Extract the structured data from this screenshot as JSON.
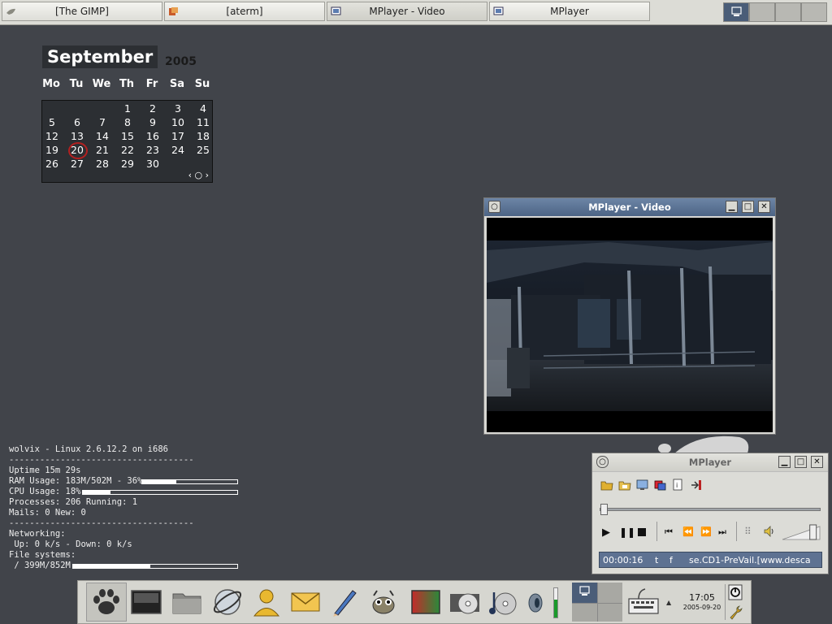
{
  "taskbar": {
    "tasks": [
      {
        "label": "[The GIMP]"
      },
      {
        "label": "[aterm]"
      },
      {
        "label": "MPlayer - Video"
      },
      {
        "label": "MPlayer"
      }
    ]
  },
  "calendar": {
    "month": "September",
    "year": "2005",
    "weekdays": [
      "Mo",
      "Tu",
      "We",
      "Th",
      "Fr",
      "Sa",
      "Su"
    ],
    "days": [
      "1",
      "2",
      "3",
      "4",
      "5",
      "6",
      "7",
      "8",
      "9",
      "10",
      "11",
      "12",
      "13",
      "14",
      "15",
      "16",
      "17",
      "18",
      "19",
      "20",
      "21",
      "22",
      "23",
      "24",
      "25",
      "26",
      "27",
      "28",
      "29",
      "30"
    ],
    "today": "20",
    "nav": "‹ ○ ›"
  },
  "conky": {
    "header": "wolvix - Linux 2.6.12.2 on i686",
    "separator": "------------------------------------",
    "uptime": "Uptime 15m 29s",
    "ram": "RAM Usage: 183M/502M - 36%",
    "ram_fraction": 0.36,
    "cpu": "CPU Usage: 18%",
    "cpu_fraction": 0.18,
    "processes": "Processes: 206  Running: 1",
    "mails": "Mails: 0 New: 0",
    "networking": "Networking:",
    "net_rates": " Up: 0 k/s - Down: 0 k/s",
    "filesystems": "File systems:",
    "fs": " / 399M/852M",
    "fs_fraction": 0.47
  },
  "video_window": {
    "title": "MPlayer - Video"
  },
  "mplayer": {
    "title": "MPlayer",
    "time": "00:00:16",
    "flag_t": "t",
    "flag_f": "f",
    "filename": "se.CD1-PreVail.[www.desca",
    "seek_fraction": 0.0,
    "volume_fraction": 0.85
  },
  "clock": {
    "time": "17:05",
    "date": "2005-09-20"
  },
  "colors": {
    "desktop": "#41444a",
    "titlebar_active": "#5b7290",
    "titlebar_inactive": "#d4d4ce"
  }
}
